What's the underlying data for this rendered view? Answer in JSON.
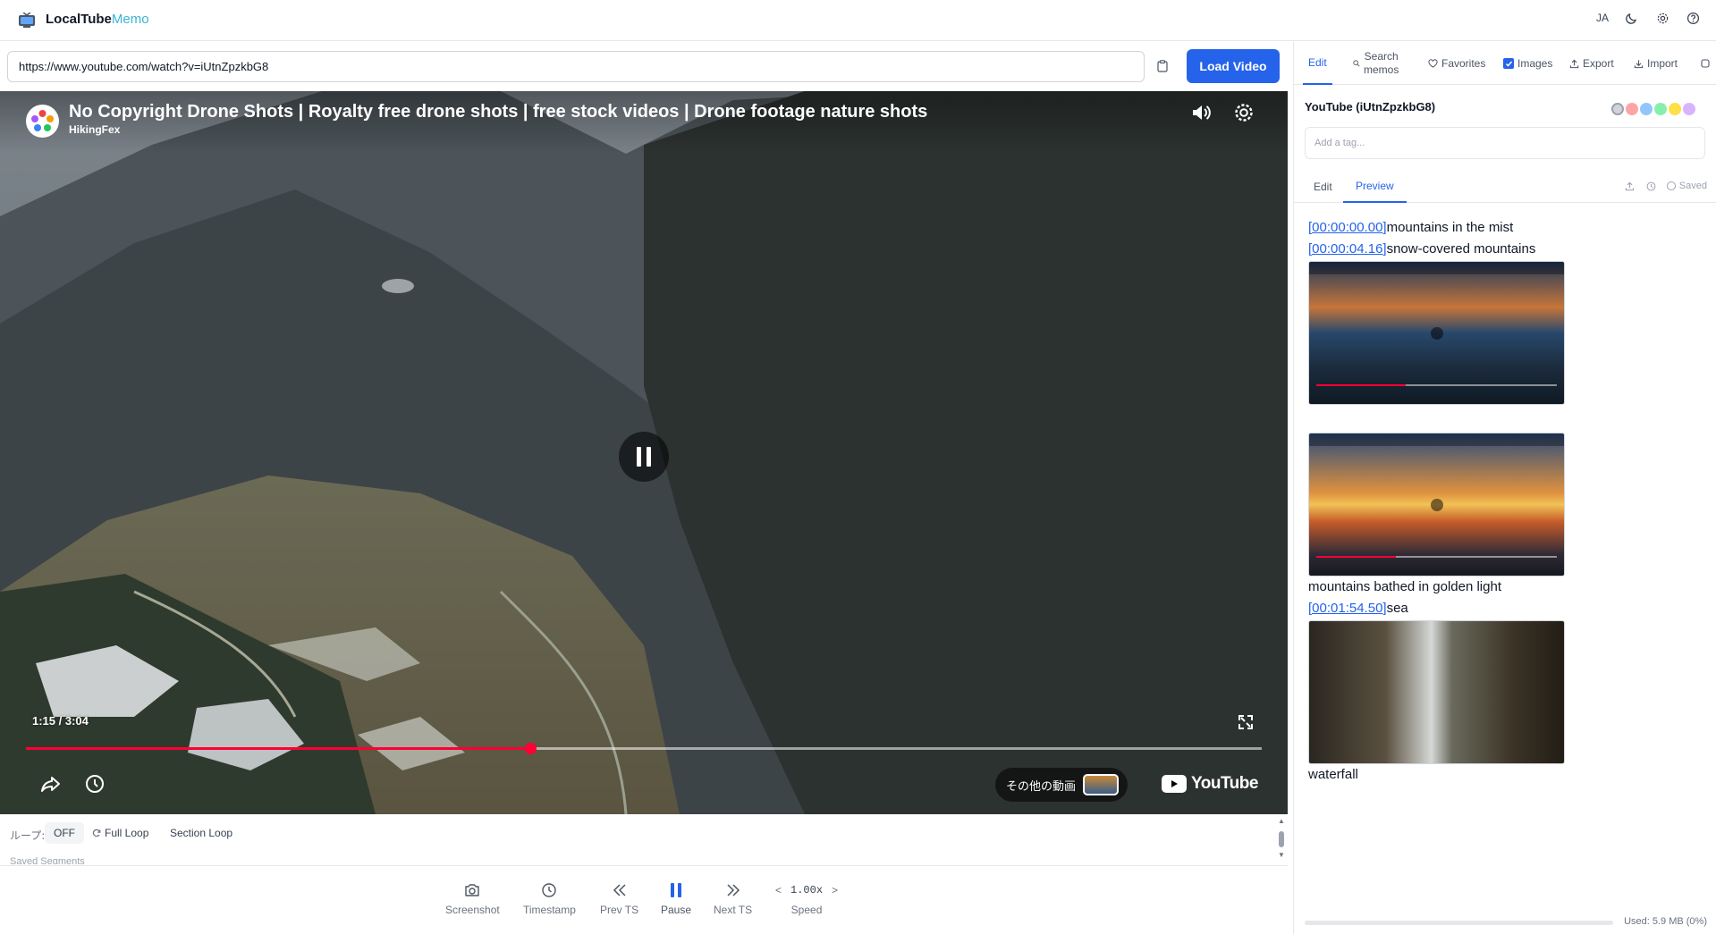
{
  "app": {
    "name_part1": "LocalTube",
    "name_part2": "Memo",
    "language": "JA",
    "accent_color": "#2563eb"
  },
  "urlbar": {
    "value": "https://www.youtube.com/watch?v=iUtnZpzkbG8",
    "load_label": "Load Video"
  },
  "player": {
    "title": "No Copyright Drone Shots | Royalty free drone shots | free stock videos | Drone footage nature shots",
    "channel": "HikingFex",
    "time": "1:15 / 3:04",
    "progress_fraction": 0.408,
    "more_videos_label": "その他の動画",
    "brand": "YouTube"
  },
  "loop": {
    "label": "ループ:",
    "off_label": "OFF",
    "full_loop_label": "Full Loop",
    "section_loop_label": "Section Loop",
    "saved_segments_label": "Saved Segments"
  },
  "controls": {
    "screenshot": "Screenshot",
    "timestamp": "Timestamp",
    "prev": "Prev TS",
    "pause": "Pause",
    "next": "Next TS",
    "speed_value": "1.00x",
    "speed_label": "Speed",
    "speed_down": "<",
    "speed_up": ">"
  },
  "panel": {
    "tabs": {
      "edit": "Edit",
      "search_line1": "Search",
      "search_line2": "memos",
      "favorites": "Favorites",
      "images": "Images",
      "export": "Export",
      "import": "Import"
    },
    "memo_title": "YouTube (iUtnZpzkbG8)",
    "tag_placeholder": "Add a tag...",
    "subtabs": {
      "edit": "Edit",
      "preview": "Preview"
    },
    "saved_label": "Saved",
    "tag_colors": [
      "#d1d5db",
      "#fca5a5",
      "#93c5fd",
      "#86efac",
      "#fde047",
      "#d8b4fe"
    ],
    "preview": {
      "line1_ts": "[00:00:00.00]",
      "line1_text": "mountains in the mist",
      "line2_ts": "[00:00:04.16]",
      "line2_text": "snow-covered mountains",
      "line3_text": "mountains bathed in golden light",
      "line4_ts": "[00:01:54.50]",
      "line4_text": "sea",
      "line5_text": "waterfall"
    },
    "storage_label": "Used: 5.9 MB (0%)"
  }
}
